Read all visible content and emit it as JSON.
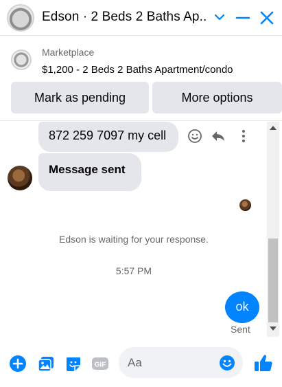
{
  "header": {
    "title": "Edson · 2 Beds 2 Baths Ap...",
    "icons": [
      "chevron-down-icon",
      "minimize-icon",
      "close-icon"
    ]
  },
  "listing": {
    "label": "Marketplace",
    "price_title": "$1,200 - 2 Beds 2 Baths Apartment/condo",
    "buttons": {
      "pending": "Mark as pending",
      "more": "More options"
    }
  },
  "messages": [
    {
      "from": "other",
      "text": "872 259 7097 my cell"
    },
    {
      "from": "other",
      "text": "Message sent"
    },
    {
      "from": "me",
      "text": "ok",
      "status": "Sent"
    }
  ],
  "waiting_notice": "Edson is waiting for your response.",
  "timestamp": "5:57 PM",
  "composer": {
    "placeholder": "Aa"
  },
  "colors": {
    "accent": "#0084ff",
    "bubble_gray": "#e4e6eb",
    "muted_text": "#65676b"
  }
}
